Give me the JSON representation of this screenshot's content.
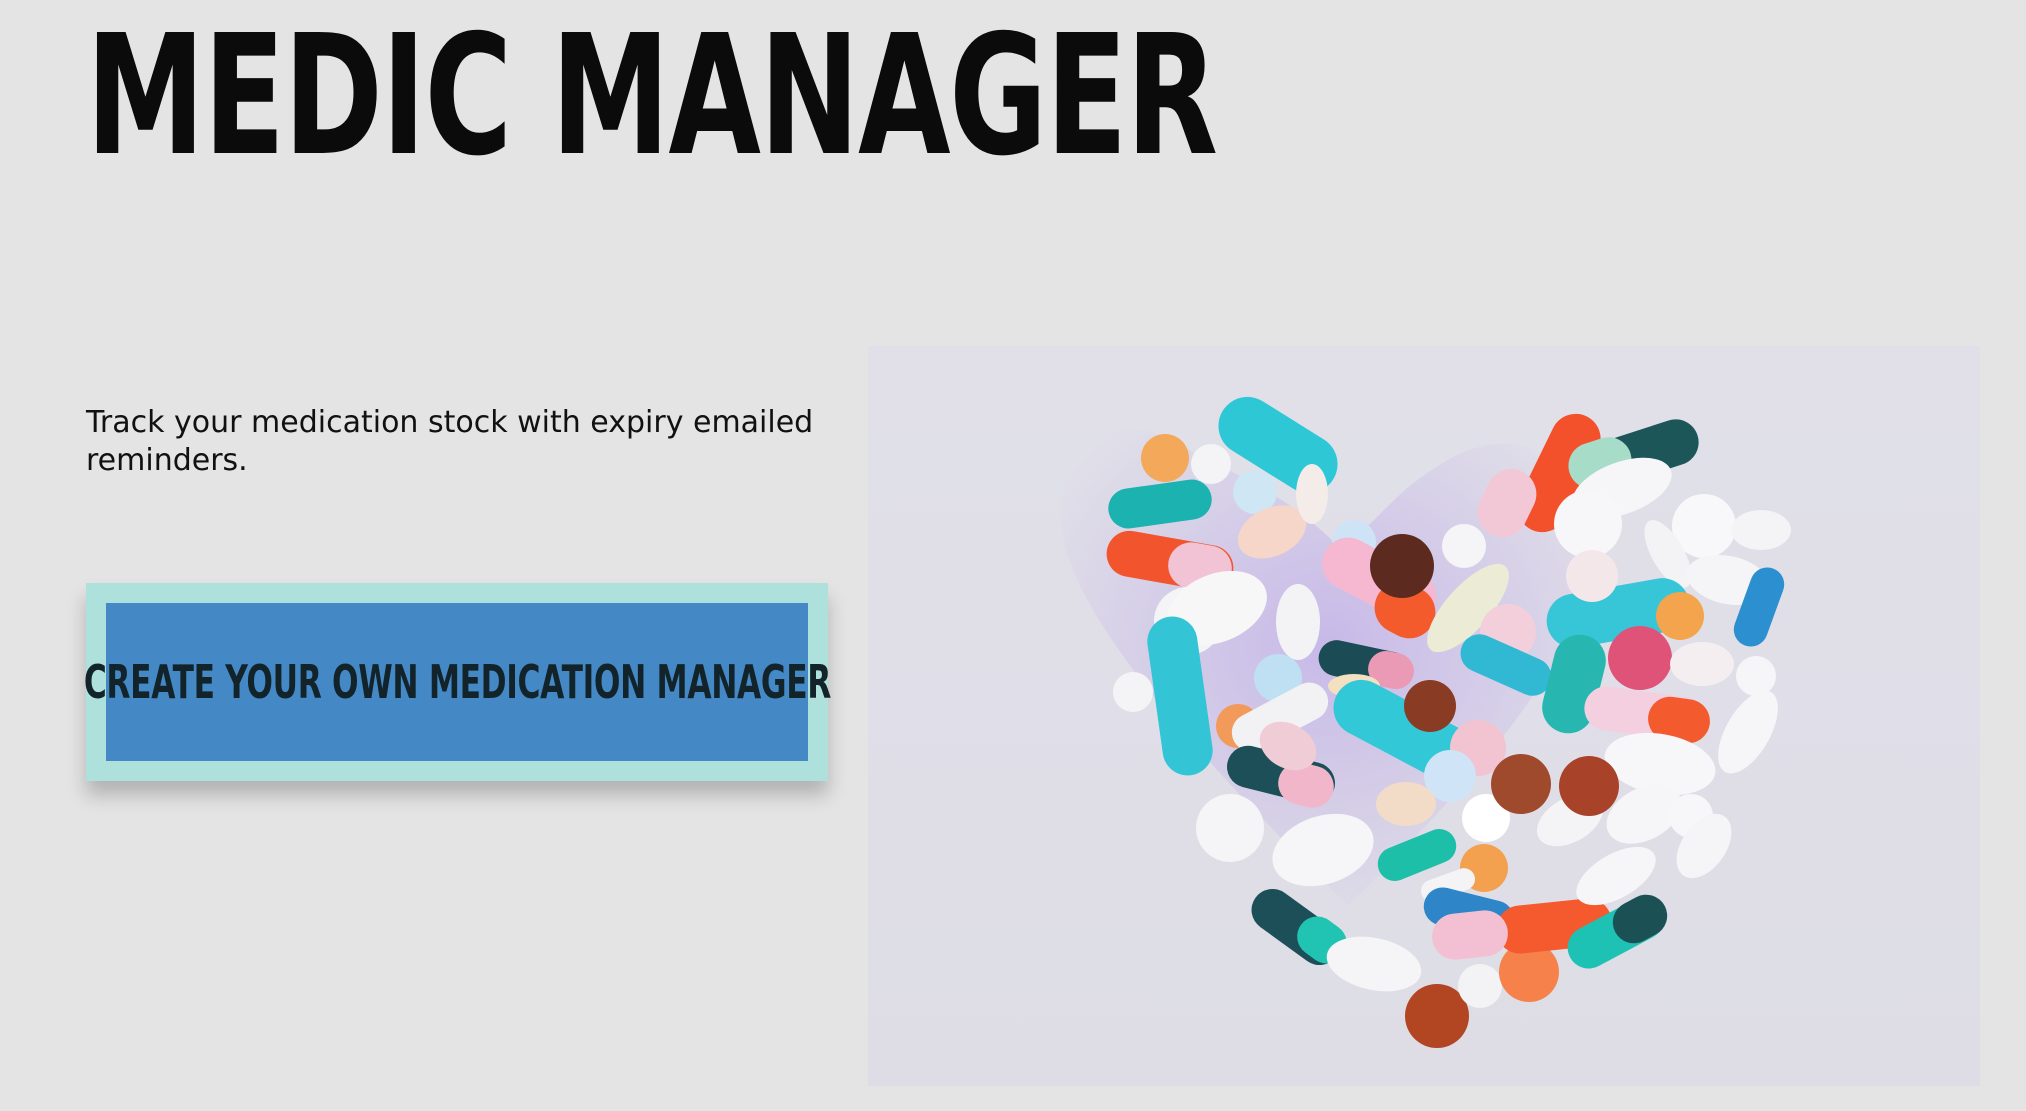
{
  "header": {
    "title": "MEDIC MANAGER"
  },
  "hero": {
    "tagline": "Track your medication stock with expiry emailed reminders.",
    "cta_label": "CREATE YOUR OWN MEDICATION MANAGER",
    "image_subject": "pills-heart-photo"
  },
  "colors": {
    "background": "#e4e4e4",
    "cta_frame": "#aee0dc",
    "cta_button": "#4488c6",
    "cta_text": "#12242a",
    "title_text": "#0b0b0b"
  }
}
